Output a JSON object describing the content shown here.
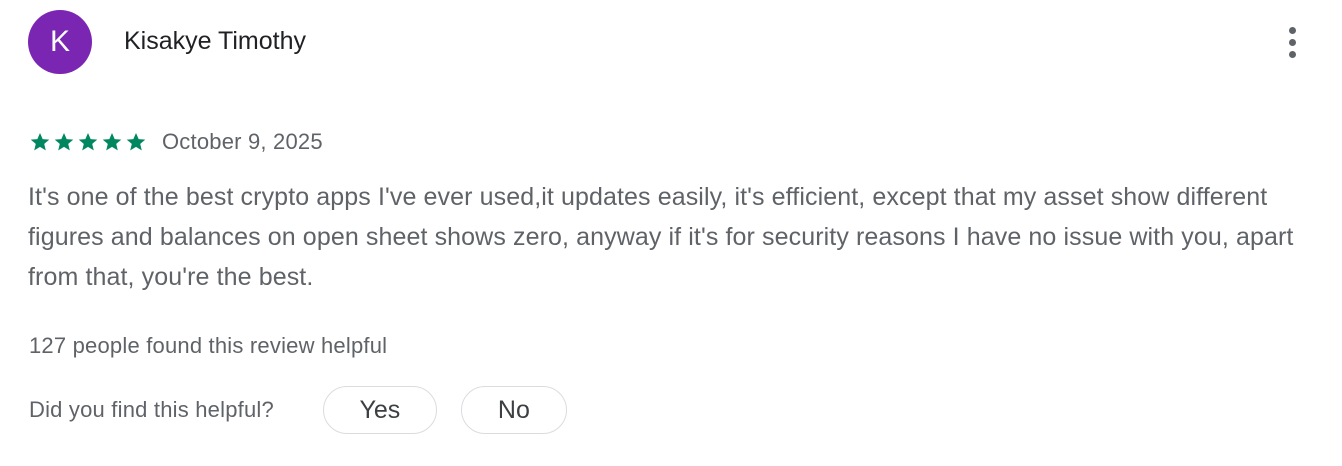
{
  "colors": {
    "avatar_bg": "#7b25b3",
    "star": "#01875f",
    "secondary_text": "#5f6368",
    "border": "#dadce0"
  },
  "reviewer": {
    "initial": "K",
    "name": "Kisakye Timothy"
  },
  "menu": {
    "icon": "more-vert-icon"
  },
  "review": {
    "rating": 5,
    "rating_max": 5,
    "date": "October 9, 2025",
    "text": "It's one of the best crypto apps I've ever used,it updates easily, it's efficient, except that my asset show different figures and balances on open sheet shows zero, anyway if it's for security reasons I have no issue with you, apart from that, you're the best."
  },
  "helpful": {
    "count_text": "127 people found this review helpful",
    "question": "Did you find this helpful?",
    "yes_label": "Yes",
    "no_label": "No"
  }
}
